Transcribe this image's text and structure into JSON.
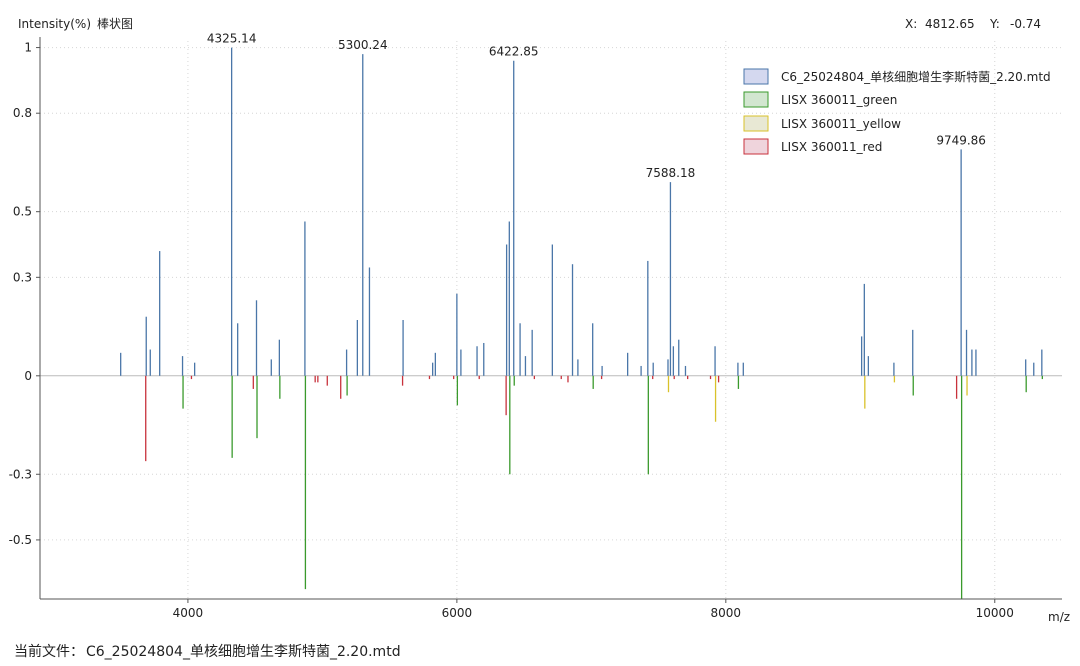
{
  "window": {
    "status_prefix": "当前文件：",
    "status_file": "C6_25024804_单核细胞增生李斯特菌_2.20.mtd",
    "cursor_x_label": "X:",
    "cursor_x_value": "4812.65",
    "cursor_y_label": "Y:",
    "cursor_y_value": "-0.74"
  },
  "chart_data": {
    "type": "bar",
    "ylabel": "Intensity(%)",
    "chart_kind_label": "棒状图",
    "xlabel": "m/z",
    "xlim": [
      2900,
      10500
    ],
    "ylim": [
      -0.68,
      1.02
    ],
    "x_ticks": [
      4000,
      6000,
      8000,
      10000
    ],
    "y_ticks": [
      -0.5,
      -0.3,
      0,
      0.3,
      0.5,
      0.8,
      1
    ],
    "y_tick_labels": [
      "-0.5",
      "-0.3",
      "0",
      "0.3",
      "0.5",
      "0.8",
      "1"
    ],
    "grid": true,
    "legend_position": "top-right",
    "colors": {
      "sample": "#4a76a8",
      "green": "#3a9a2c",
      "yellow": "#d9c22a",
      "red": "#c8323c"
    },
    "series": [
      {
        "name": "C6_25024804_单核细胞增生李斯特菌_2.20.mtd",
        "color": "#4a76a8",
        "legend_fill": "#d4d8ef",
        "points": [
          [
            3500,
            0.07
          ],
          [
            3690,
            0.18
          ],
          [
            3720,
            0.08
          ],
          [
            3790,
            0.38
          ],
          [
            3960,
            0.06
          ],
          [
            4050,
            0.04
          ],
          [
            4325.14,
            1.0
          ],
          [
            4370,
            0.16
          ],
          [
            4510,
            0.23
          ],
          [
            4620,
            0.05
          ],
          [
            4680,
            0.11
          ],
          [
            4870,
            0.47
          ],
          [
            5180,
            0.08
          ],
          [
            5260,
            0.17
          ],
          [
            5300.24,
            0.98
          ],
          [
            5350,
            0.33
          ],
          [
            5600,
            0.17
          ],
          [
            5820,
            0.04
          ],
          [
            5840,
            0.07
          ],
          [
            6000,
            0.25
          ],
          [
            6030,
            0.08
          ],
          [
            6150,
            0.09
          ],
          [
            6200,
            0.1
          ],
          [
            6370,
            0.4
          ],
          [
            6390,
            0.47
          ],
          [
            6422.85,
            0.96
          ],
          [
            6470,
            0.16
          ],
          [
            6510,
            0.06
          ],
          [
            6560,
            0.14
          ],
          [
            6710,
            0.4
          ],
          [
            6860,
            0.34
          ],
          [
            6900,
            0.05
          ],
          [
            7010,
            0.16
          ],
          [
            7080,
            0.03
          ],
          [
            7270,
            0.07
          ],
          [
            7370,
            0.03
          ],
          [
            7420,
            0.35
          ],
          [
            7460,
            0.04
          ],
          [
            7570,
            0.05
          ],
          [
            7588.18,
            0.59
          ],
          [
            7610,
            0.09
          ],
          [
            7650,
            0.11
          ],
          [
            7700,
            0.03
          ],
          [
            7920,
            0.09
          ],
          [
            8090,
            0.04
          ],
          [
            8130,
            0.04
          ],
          [
            9010,
            0.12
          ],
          [
            9030,
            0.28
          ],
          [
            9060,
            0.06
          ],
          [
            9250,
            0.04
          ],
          [
            9390,
            0.14
          ],
          [
            9749.86,
            0.69
          ],
          [
            9790,
            0.14
          ],
          [
            9830,
            0.08
          ],
          [
            9860,
            0.08
          ],
          [
            10230,
            0.05
          ],
          [
            10290,
            0.04
          ],
          [
            10350,
            0.08
          ]
        ]
      },
      {
        "name": "LISX 360011_green",
        "color": "#3a9a2c",
        "legend_fill": "#d2e6d0",
        "points": [
          [
            3960,
            -0.1
          ],
          [
            4325.14,
            -0.25
          ],
          [
            4510,
            -0.19
          ],
          [
            4680,
            -0.07
          ],
          [
            4870,
            -0.65
          ],
          [
            5180,
            -0.06
          ],
          [
            6000,
            -0.09
          ],
          [
            6390,
            -0.3
          ],
          [
            6422.85,
            -0.03
          ],
          [
            7010,
            -0.04
          ],
          [
            7420,
            -0.3
          ],
          [
            8090,
            -0.04
          ],
          [
            9390,
            -0.06
          ],
          [
            9749.86,
            -0.68
          ],
          [
            10230,
            -0.05
          ],
          [
            10350,
            -0.01
          ]
        ]
      },
      {
        "name": "LISX 360011_yellow",
        "color": "#d9c22a",
        "legend_fill": "#e8e8d4",
        "points": [
          [
            7570,
            -0.05
          ],
          [
            7920,
            -0.14
          ],
          [
            9030,
            -0.1
          ],
          [
            9250,
            -0.02
          ],
          [
            9790,
            -0.06
          ]
        ]
      },
      {
        "name": "LISX 360011_red",
        "color": "#c8323c",
        "legend_fill": "#efd4dc",
        "points": [
          [
            3690,
            -0.26
          ],
          [
            4030,
            -0.01
          ],
          [
            4490,
            -0.04
          ],
          [
            4950,
            -0.02
          ],
          [
            4970,
            -0.02
          ],
          [
            5040,
            -0.03
          ],
          [
            5140,
            -0.07
          ],
          [
            5600,
            -0.03
          ],
          [
            5800,
            -0.01
          ],
          [
            5980,
            -0.01
          ],
          [
            6170,
            -0.01
          ],
          [
            6370,
            -0.12
          ],
          [
            6580,
            -0.01
          ],
          [
            6780,
            -0.01
          ],
          [
            6830,
            -0.02
          ],
          [
            7080,
            -0.01
          ],
          [
            7460,
            -0.01
          ],
          [
            7620,
            -0.01
          ],
          [
            7720,
            -0.01
          ],
          [
            7890,
            -0.01
          ],
          [
            7950,
            -0.02
          ],
          [
            9720,
            -0.07
          ]
        ]
      }
    ],
    "peak_labels": [
      {
        "x": 4325.14,
        "y": 1.0,
        "text": "4325.14"
      },
      {
        "x": 5300.24,
        "y": 0.98,
        "text": "5300.24"
      },
      {
        "x": 6422.85,
        "y": 0.96,
        "text": "6422.85"
      },
      {
        "x": 7588.18,
        "y": 0.59,
        "text": "7588.18"
      },
      {
        "x": 9749.86,
        "y": 0.69,
        "text": "9749.86"
      }
    ]
  }
}
